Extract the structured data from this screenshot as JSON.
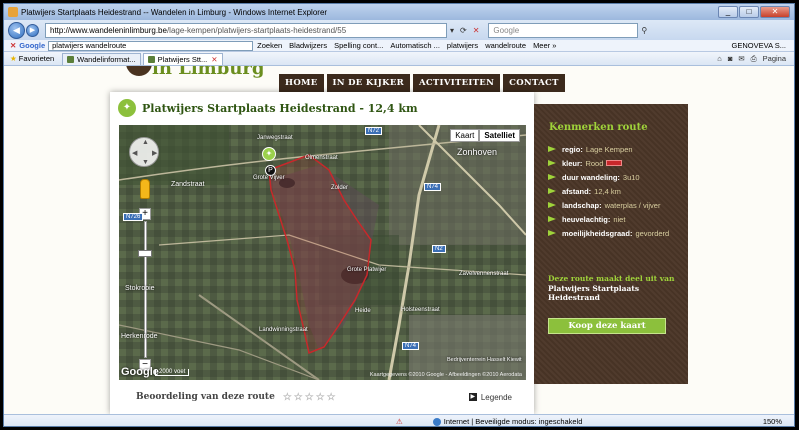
{
  "window": {
    "title": "Platwijers Startplaats Heidestrand -- Wandelen in Limburg - Windows Internet Explorer",
    "minimize": "_",
    "maximize": "□",
    "close": "✕"
  },
  "address": {
    "url_host": "http://www.wandeleninlimburg.be",
    "url_path": "/lage-kempen/platwijers-startplaats-heidestrand/55",
    "search_placeholder": "Google"
  },
  "google_toolbar": {
    "logo": "Google",
    "query": "platwijers wandelroute",
    "items": [
      "Zoeken",
      "Bladwijzers",
      "Spelling cont...",
      "Automatisch ...",
      "platwijers",
      "wandelroute",
      "Meer »"
    ],
    "account": "GENOVEVA S..."
  },
  "tabs": {
    "favorites": "Favorieten",
    "list": [
      {
        "label": "Wandelinformat...",
        "active": false
      },
      {
        "label": "Platwijers Stt...",
        "active": true
      }
    ],
    "page_menu": "Pagina"
  },
  "site": {
    "logo": "in Limburg",
    "nav": [
      "HOME",
      "IN DE KIJKER",
      "ACTIVITEITEN",
      "CONTACT"
    ]
  },
  "route": {
    "title": "Platwijers Startplaats Heidestrand - 12,4 km",
    "map": {
      "type_buttons": [
        "Kaart",
        "Satelliet"
      ],
      "active_type": "Satelliet",
      "labels": [
        "Zonhoven",
        "Zandstraat",
        "Grote Vijver",
        "Grote Platwijer",
        "Zolder",
        "Heide",
        "Herkenrode",
        "Stokrooie",
        "Janwegstraat",
        "Zavelvennenstraat",
        "Landwinningstraat",
        "Holsteenstraat",
        "Olmenstraat",
        "Bedrijventerrein Hasselt Kiewit"
      ],
      "road_signs": [
        "N72",
        "N74",
        "N726",
        "N2",
        "N74"
      ],
      "scale": "2000 voet",
      "copyright": "Kaartgegevens ©2010 Google - Afbeeldingen ©2010 Aerodata",
      "google": "Google"
    },
    "rating_label": "Beoordeling van deze route",
    "stars": "☆☆☆☆☆",
    "legend": "Legende"
  },
  "panel": {
    "title": "Kenmerken route",
    "properties": [
      {
        "key": "regio:",
        "value": "Lage Kempen"
      },
      {
        "key": "kleur:",
        "value": "Rood"
      },
      {
        "key": "duur wandeling:",
        "value": "3u10"
      },
      {
        "key": "afstand:",
        "value": "12,4 km"
      },
      {
        "key": "landschap:",
        "value": "waterplas / vijver"
      },
      {
        "key": "heuvelachtig:",
        "value": "niet"
      },
      {
        "key": "moeilijkheidsgraad:",
        "value": "gevorderd"
      }
    ],
    "note_prefix": "Deze route maakt deel uit van",
    "note_network": "Platwijers Startplaats Heidestrand",
    "buy_button": "Koop deze kaart",
    "route_color": "#c8282b",
    "accent": "#9fd33a"
  },
  "status": {
    "zone": "Internet | Beveiligde modus: ingeschakeld",
    "zoom": "150%"
  }
}
